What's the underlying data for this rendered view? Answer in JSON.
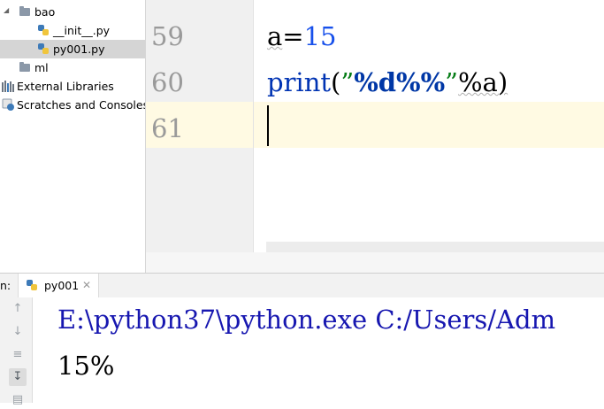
{
  "project_tree": {
    "items": [
      {
        "label": "bao",
        "type": "package"
      },
      {
        "label": "__init__.py",
        "type": "python-file"
      },
      {
        "label": "py001.py",
        "type": "python-file",
        "selected": true
      },
      {
        "label": "ml",
        "type": "folder"
      },
      {
        "label": "External Libraries",
        "type": "libraries"
      },
      {
        "label": "Scratches and Consoles",
        "type": "scratches"
      }
    ]
  },
  "editor": {
    "line_numbers": [
      "59",
      "60",
      "61"
    ],
    "current_line": "61",
    "code": {
      "line59": {
        "var": "a",
        "op": "=",
        "num": "15"
      },
      "line60": {
        "fn": "print",
        "open": "(",
        "q1": "”",
        "fmt1": "%d",
        "fmt2": "%%",
        "q2": "”",
        "rest": "%a)"
      }
    }
  },
  "run": {
    "label": "n:",
    "tab_label": "py001",
    "console": {
      "command": "E:\\python37\\python.exe C:/Users/Adm",
      "output": "15%"
    }
  },
  "colors": {
    "number": "#1750eb",
    "keyword": "#0033b3",
    "string": "#067d17",
    "current_line": "#fffae3",
    "console_command": "#1717b0"
  }
}
